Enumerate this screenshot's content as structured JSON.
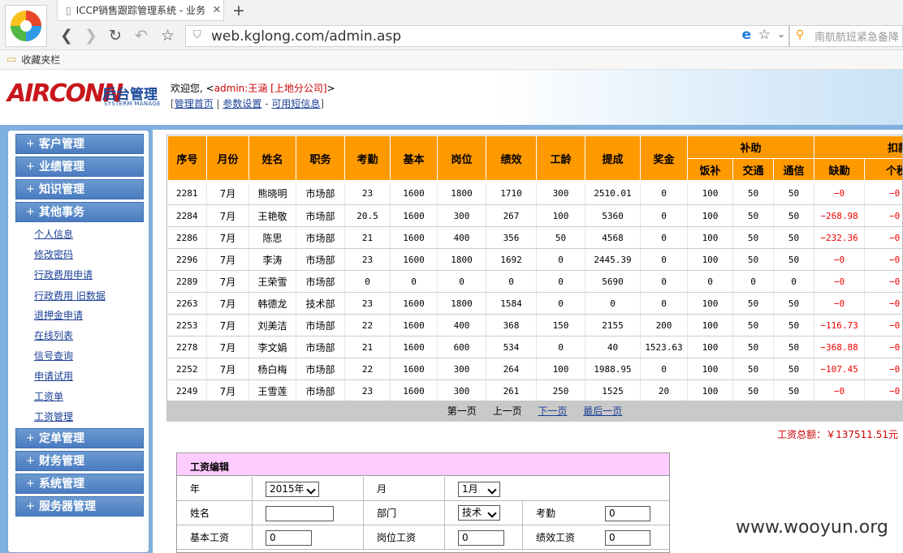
{
  "browser": {
    "tab_title": "ICCP销售跟踪管理系统 - 业务",
    "url": "web.kglong.com/admin.asp",
    "search_text": "南航航班紧急备降",
    "bookmark_label": "收藏夹栏"
  },
  "header": {
    "logo_text": "AIRCONN",
    "logo_cn": "后台管理",
    "logo_en": "SYSTERM MANAGE",
    "welcome_prefix": "欢迎您, <",
    "welcome_user": "admin:王涵 [上地分公司]",
    "welcome_suffix": ">",
    "links": [
      "管理首页",
      "参数设置",
      "可用短信息"
    ]
  },
  "sidebar": {
    "menus": [
      "客户管理",
      "业绩管理",
      "知识管理",
      "其他事务"
    ],
    "sub_items": [
      "个人信息",
      "修改密码",
      "行政费用申请",
      "行政费用 旧数据",
      "退押金申请",
      "在线列表",
      "信号查询",
      "申请试用",
      "工资单",
      "工资管理"
    ],
    "menus_bottom": [
      "定单管理",
      "财务管理",
      "系统管理",
      "服务器管理"
    ]
  },
  "grid": {
    "headers": [
      "序号",
      "月份",
      "姓名",
      "职务",
      "考勤",
      "基本",
      "岗位",
      "绩效",
      "工龄",
      "提成",
      "奖金"
    ],
    "group_headers": [
      "补助",
      "扣款"
    ],
    "sub_headers": [
      "饭补",
      "交通",
      "通信",
      "缺勤",
      "个税"
    ],
    "rows": [
      [
        "2281",
        "7月",
        "熊晓明",
        "市场部",
        "23",
        "1600",
        "1800",
        "1710",
        "300",
        "2510.01",
        "0",
        "100",
        "50",
        "50",
        "−0",
        "−0"
      ],
      [
        "2284",
        "7月",
        "王艳敬",
        "市场部",
        "20.5",
        "1600",
        "300",
        "267",
        "100",
        "5360",
        "0",
        "100",
        "50",
        "50",
        "−268.98",
        "−0"
      ],
      [
        "2286",
        "7月",
        "陈思",
        "市场部",
        "21",
        "1600",
        "400",
        "356",
        "50",
        "4568",
        "0",
        "100",
        "50",
        "50",
        "−232.36",
        "−0"
      ],
      [
        "2296",
        "7月",
        "李涛",
        "市场部",
        "23",
        "1600",
        "1800",
        "1692",
        "0",
        "2445.39",
        "0",
        "100",
        "50",
        "50",
        "−0",
        "−0"
      ],
      [
        "2289",
        "7月",
        "王荣雪",
        "市场部",
        "0",
        "0",
        "0",
        "0",
        "0",
        "5690",
        "0",
        "0",
        "0",
        "0",
        "−0",
        "−0"
      ],
      [
        "2263",
        "7月",
        "韩德龙",
        "技术部",
        "23",
        "1600",
        "1800",
        "1584",
        "0",
        "0",
        "0",
        "100",
        "50",
        "50",
        "−0",
        "−0"
      ],
      [
        "2253",
        "7月",
        "刘美洁",
        "市场部",
        "22",
        "1600",
        "400",
        "368",
        "150",
        "2155",
        "200",
        "100",
        "50",
        "50",
        "−116.73",
        "−0"
      ],
      [
        "2278",
        "7月",
        "李文娟",
        "市场部",
        "21",
        "1600",
        "600",
        "534",
        "0",
        "40",
        "1523.63",
        "100",
        "50",
        "50",
        "−368.88",
        "−0"
      ],
      [
        "2252",
        "7月",
        "杨白梅",
        "市场部",
        "22",
        "1600",
        "300",
        "264",
        "100",
        "1988.95",
        "0",
        "100",
        "50",
        "50",
        "−107.45",
        "−0"
      ],
      [
        "2249",
        "7月",
        "王雪莲",
        "市场部",
        "23",
        "1600",
        "300",
        "261",
        "250",
        "1525",
        "20",
        "100",
        "50",
        "50",
        "−0",
        "−0"
      ]
    ],
    "pager": [
      "第一页",
      "上一页",
      "下一页",
      "最后一页"
    ],
    "total": "工资总额：￥137511.51元"
  },
  "edit": {
    "title": "工资编辑",
    "year_label": "年",
    "year_value": "2015年",
    "month_label": "月",
    "month_value": "1月",
    "name_label": "姓名",
    "dept_label": "部门",
    "dept_value": "技术",
    "att_label": "考勤",
    "att_value": "0",
    "base_label": "基本工资",
    "base_value": "0",
    "post_label": "岗位工资",
    "post_value": "0",
    "perf_label": "绩效工资",
    "perf_value": "0"
  },
  "watermark": "www.wooyun.org"
}
